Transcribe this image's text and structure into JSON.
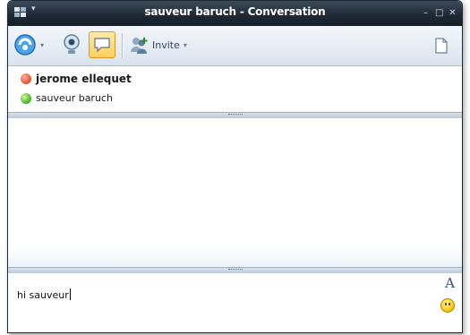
{
  "window": {
    "title": "sauveur baruch - Conversation"
  },
  "titlebar": {
    "menu_arrow": "▾",
    "minimize": "–",
    "maximize": "□",
    "close": "✕"
  },
  "toolbar": {
    "invite_label": "Invite",
    "items": [
      {
        "name": "messenger-menu",
        "icon": "messenger-logo-icon"
      },
      {
        "name": "webcam",
        "icon": "webcam-icon"
      },
      {
        "name": "conversation",
        "icon": "speech-bubble-icon"
      },
      {
        "name": "invite",
        "icon": "add-people-icon"
      },
      {
        "name": "share-files",
        "icon": "document-icon"
      }
    ],
    "dropdown_arrow": "▾"
  },
  "contacts": [
    {
      "name": "jerome ellequet",
      "status": "busy",
      "status_color": "#e8553a",
      "bold": true
    },
    {
      "name": "sauveur baruch",
      "status": "online",
      "status_color": "#49b829",
      "bold": false
    }
  ],
  "compose": {
    "text": "hi sauveur",
    "font_button": "A"
  },
  "colors": {
    "titlebar": "#1d2833",
    "active_tool": "#ffcf5a"
  }
}
